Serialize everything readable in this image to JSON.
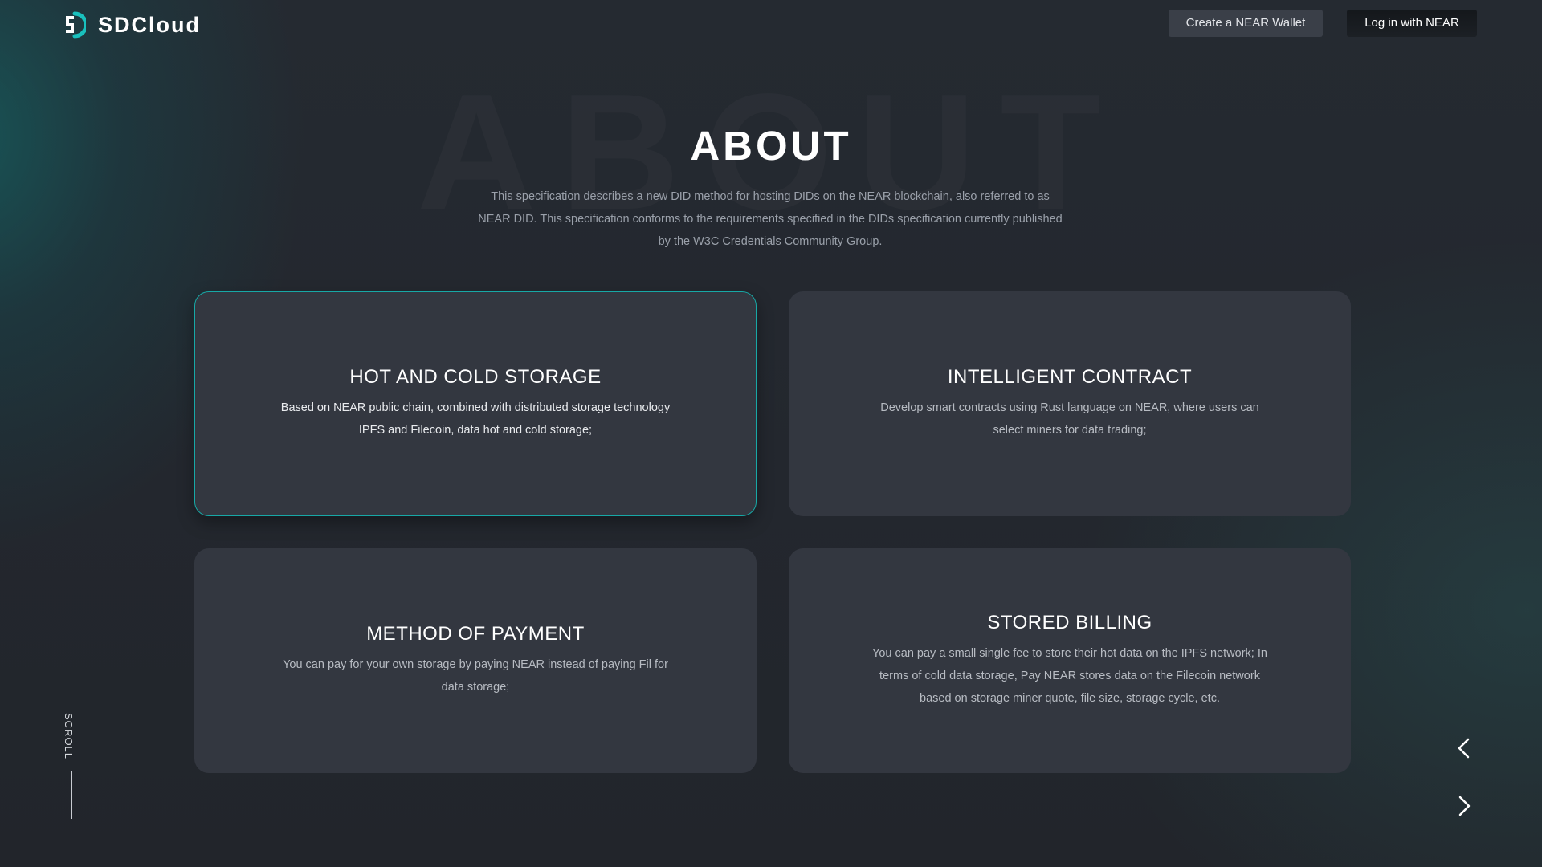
{
  "header": {
    "brand": "SDCloud",
    "create_wallet_label": "Create a NEAR Wallet",
    "login_label": "Log in with NEAR"
  },
  "hero": {
    "background_word": "ABOUT",
    "title": "ABOUT",
    "description": "This specification describes a new DID method for hosting DIDs on the NEAR blockchain, also referred to as NEAR DID. This specification conforms to the requirements specified in the DIDs specification currently published by the W3C Credentials Community Group."
  },
  "cards": [
    {
      "title": "HOT AND COLD STORAGE",
      "text": "Based on NEAR public chain, combined with distributed storage technology IPFS and Filecoin, data hot and cold storage;",
      "active": true
    },
    {
      "title": "INTELLIGENT CONTRACT",
      "text": "Develop smart contracts using Rust language on NEAR, where users can select miners for data trading;",
      "active": false
    },
    {
      "title": "METHOD OF PAYMENT",
      "text": "You can pay for your own storage by paying NEAR instead of paying Fil for data storage;",
      "active": false
    },
    {
      "title": "STORED BILLING",
      "text": "You can pay a small single fee to store their hot data on the IPFS network; In terms of cold data storage, Pay NEAR stores data on the Filecoin network based on storage miner quote, file size, storage cycle, etc.",
      "active": false
    }
  ],
  "scroll": {
    "label": "SCROLL"
  },
  "navigation": {
    "prev_icon": "chevron-left-icon",
    "next_icon": "chevron-right-icon"
  },
  "colors": {
    "accent": "#17a8a6",
    "card_background": "#333740",
    "page_background": "#22262d"
  }
}
